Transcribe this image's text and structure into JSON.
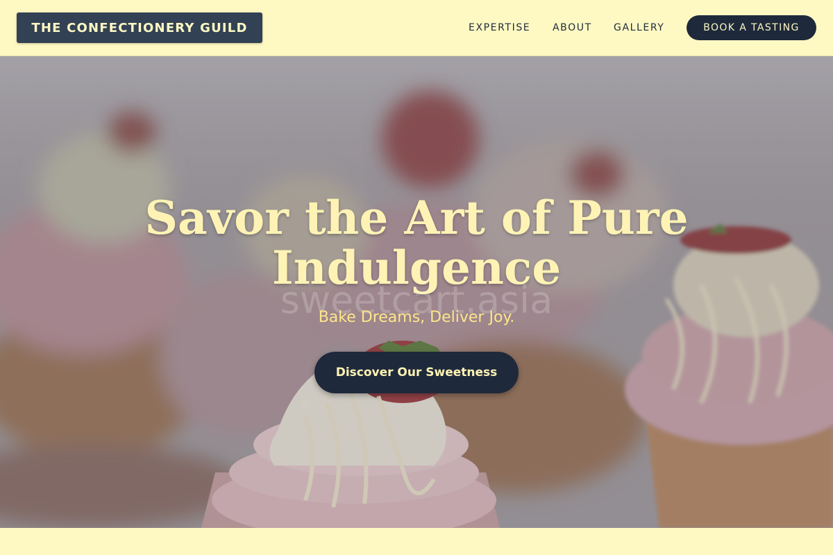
{
  "header": {
    "logo_text": "THE CONFECTIONERY GUILD",
    "nav": [
      {
        "label": "EXPERTISE"
      },
      {
        "label": "ABOUT"
      },
      {
        "label": "GALLERY"
      }
    ],
    "cta_label": "BOOK A TASTING"
  },
  "hero": {
    "title_line1": "Savor the Art of Pure",
    "title_line2": "Indulgence",
    "watermark": "sweetcart.asia",
    "subtitle": "Bake Dreams, Deliver Joy.",
    "cta_label": "Discover Our Sweetness",
    "image_subject": "cupcakes-with-strawberries-photo"
  },
  "colors": {
    "background": "#fef9c3",
    "navy": "#1e293b",
    "slate": "#334155",
    "cream_text": "#fef3b5",
    "subtitle_text": "#fde68a"
  }
}
